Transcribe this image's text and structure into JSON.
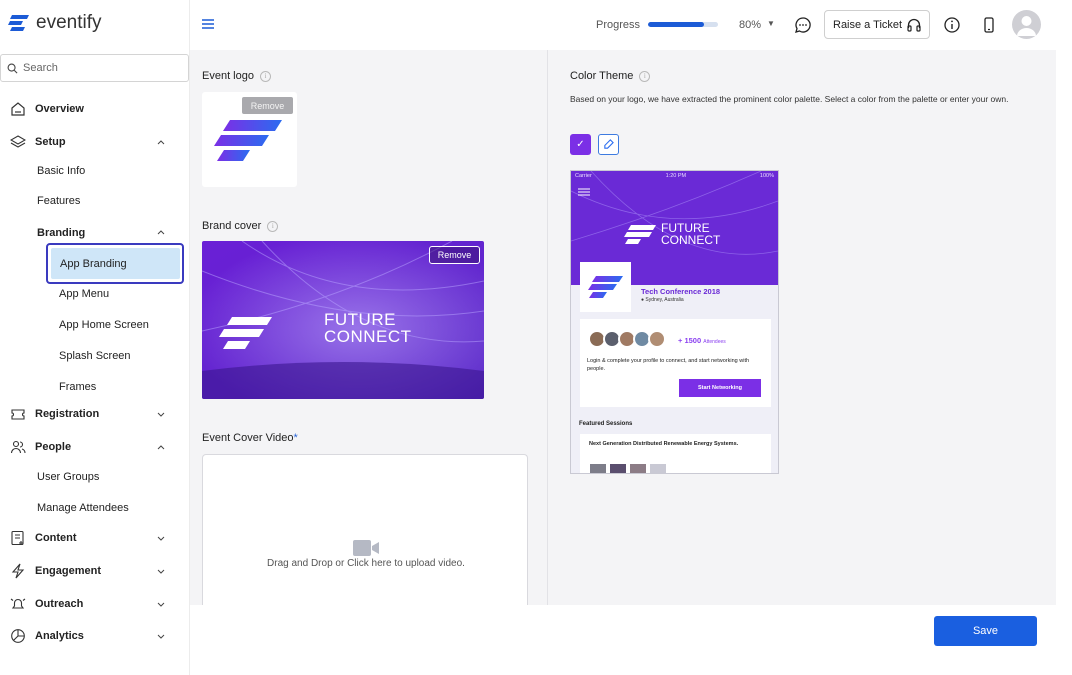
{
  "brand": {
    "name": "eventify",
    "accent": "#1c5bd6"
  },
  "sidebar": {
    "search_placeholder": "Search",
    "items": [
      {
        "label": "Overview",
        "icon": "home-icon"
      },
      {
        "label": "Setup",
        "icon": "layers-icon",
        "expanded": true
      },
      {
        "label": "Registration",
        "icon": "ticket-icon",
        "expanded": false
      },
      {
        "label": "People",
        "icon": "people-icon",
        "expanded": true
      },
      {
        "label": "Content",
        "icon": "content-icon",
        "expanded": false
      },
      {
        "label": "Engagement",
        "icon": "lightning-icon",
        "expanded": false
      },
      {
        "label": "Outreach",
        "icon": "megaphone-icon",
        "expanded": false
      },
      {
        "label": "Analytics",
        "icon": "pie-chart-icon",
        "expanded": false
      }
    ],
    "setup_children": [
      "Basic Info",
      "Features",
      "Branding"
    ],
    "branding_children": [
      "App Branding",
      "App Menu",
      "App Home Screen",
      "Splash Screen",
      "Frames"
    ],
    "people_children": [
      "User Groups",
      "Manage Attendees"
    ],
    "active": "App Branding"
  },
  "topbar": {
    "progress_label": "Progress",
    "progress_value": 80,
    "progress_pct": "80%",
    "ticket_label": "Raise a Ticket"
  },
  "main": {
    "event_logo_label": "Event logo",
    "remove_label": "Remove",
    "brand_cover_label": "Brand cover",
    "cover_text_line1": "FUTURE",
    "cover_text_line2": "CONNECT",
    "video_label": "Event Cover Video",
    "video_required": "*",
    "video_hint": "Drag and Drop or Click here to upload video.",
    "color_theme_label": "Color Theme",
    "color_theme_desc": "Based on your logo, we have extracted the prominent color palette. Select a color from the palette or enter your own.",
    "selected_color": "#7b2fe6"
  },
  "preview": {
    "status_left": "Carrier",
    "status_time": "1:20 PM",
    "status_right": "100%",
    "logo_line1": "FUTURE",
    "logo_line2": "CONNECT",
    "conf_title": "Tech Conference 2018",
    "conf_location": "Sydney, Australia",
    "attendees_count": "+ 1500",
    "attendees_label": "Attendees",
    "cta_text": "Login & complete your profile to connect, and start networking with people.",
    "cta_button": "Start Networking",
    "featured_label": "Featured Sessions",
    "session_title": "Next Generation Distributed Renewable Energy Systems."
  },
  "footer": {
    "save_label": "Save"
  }
}
